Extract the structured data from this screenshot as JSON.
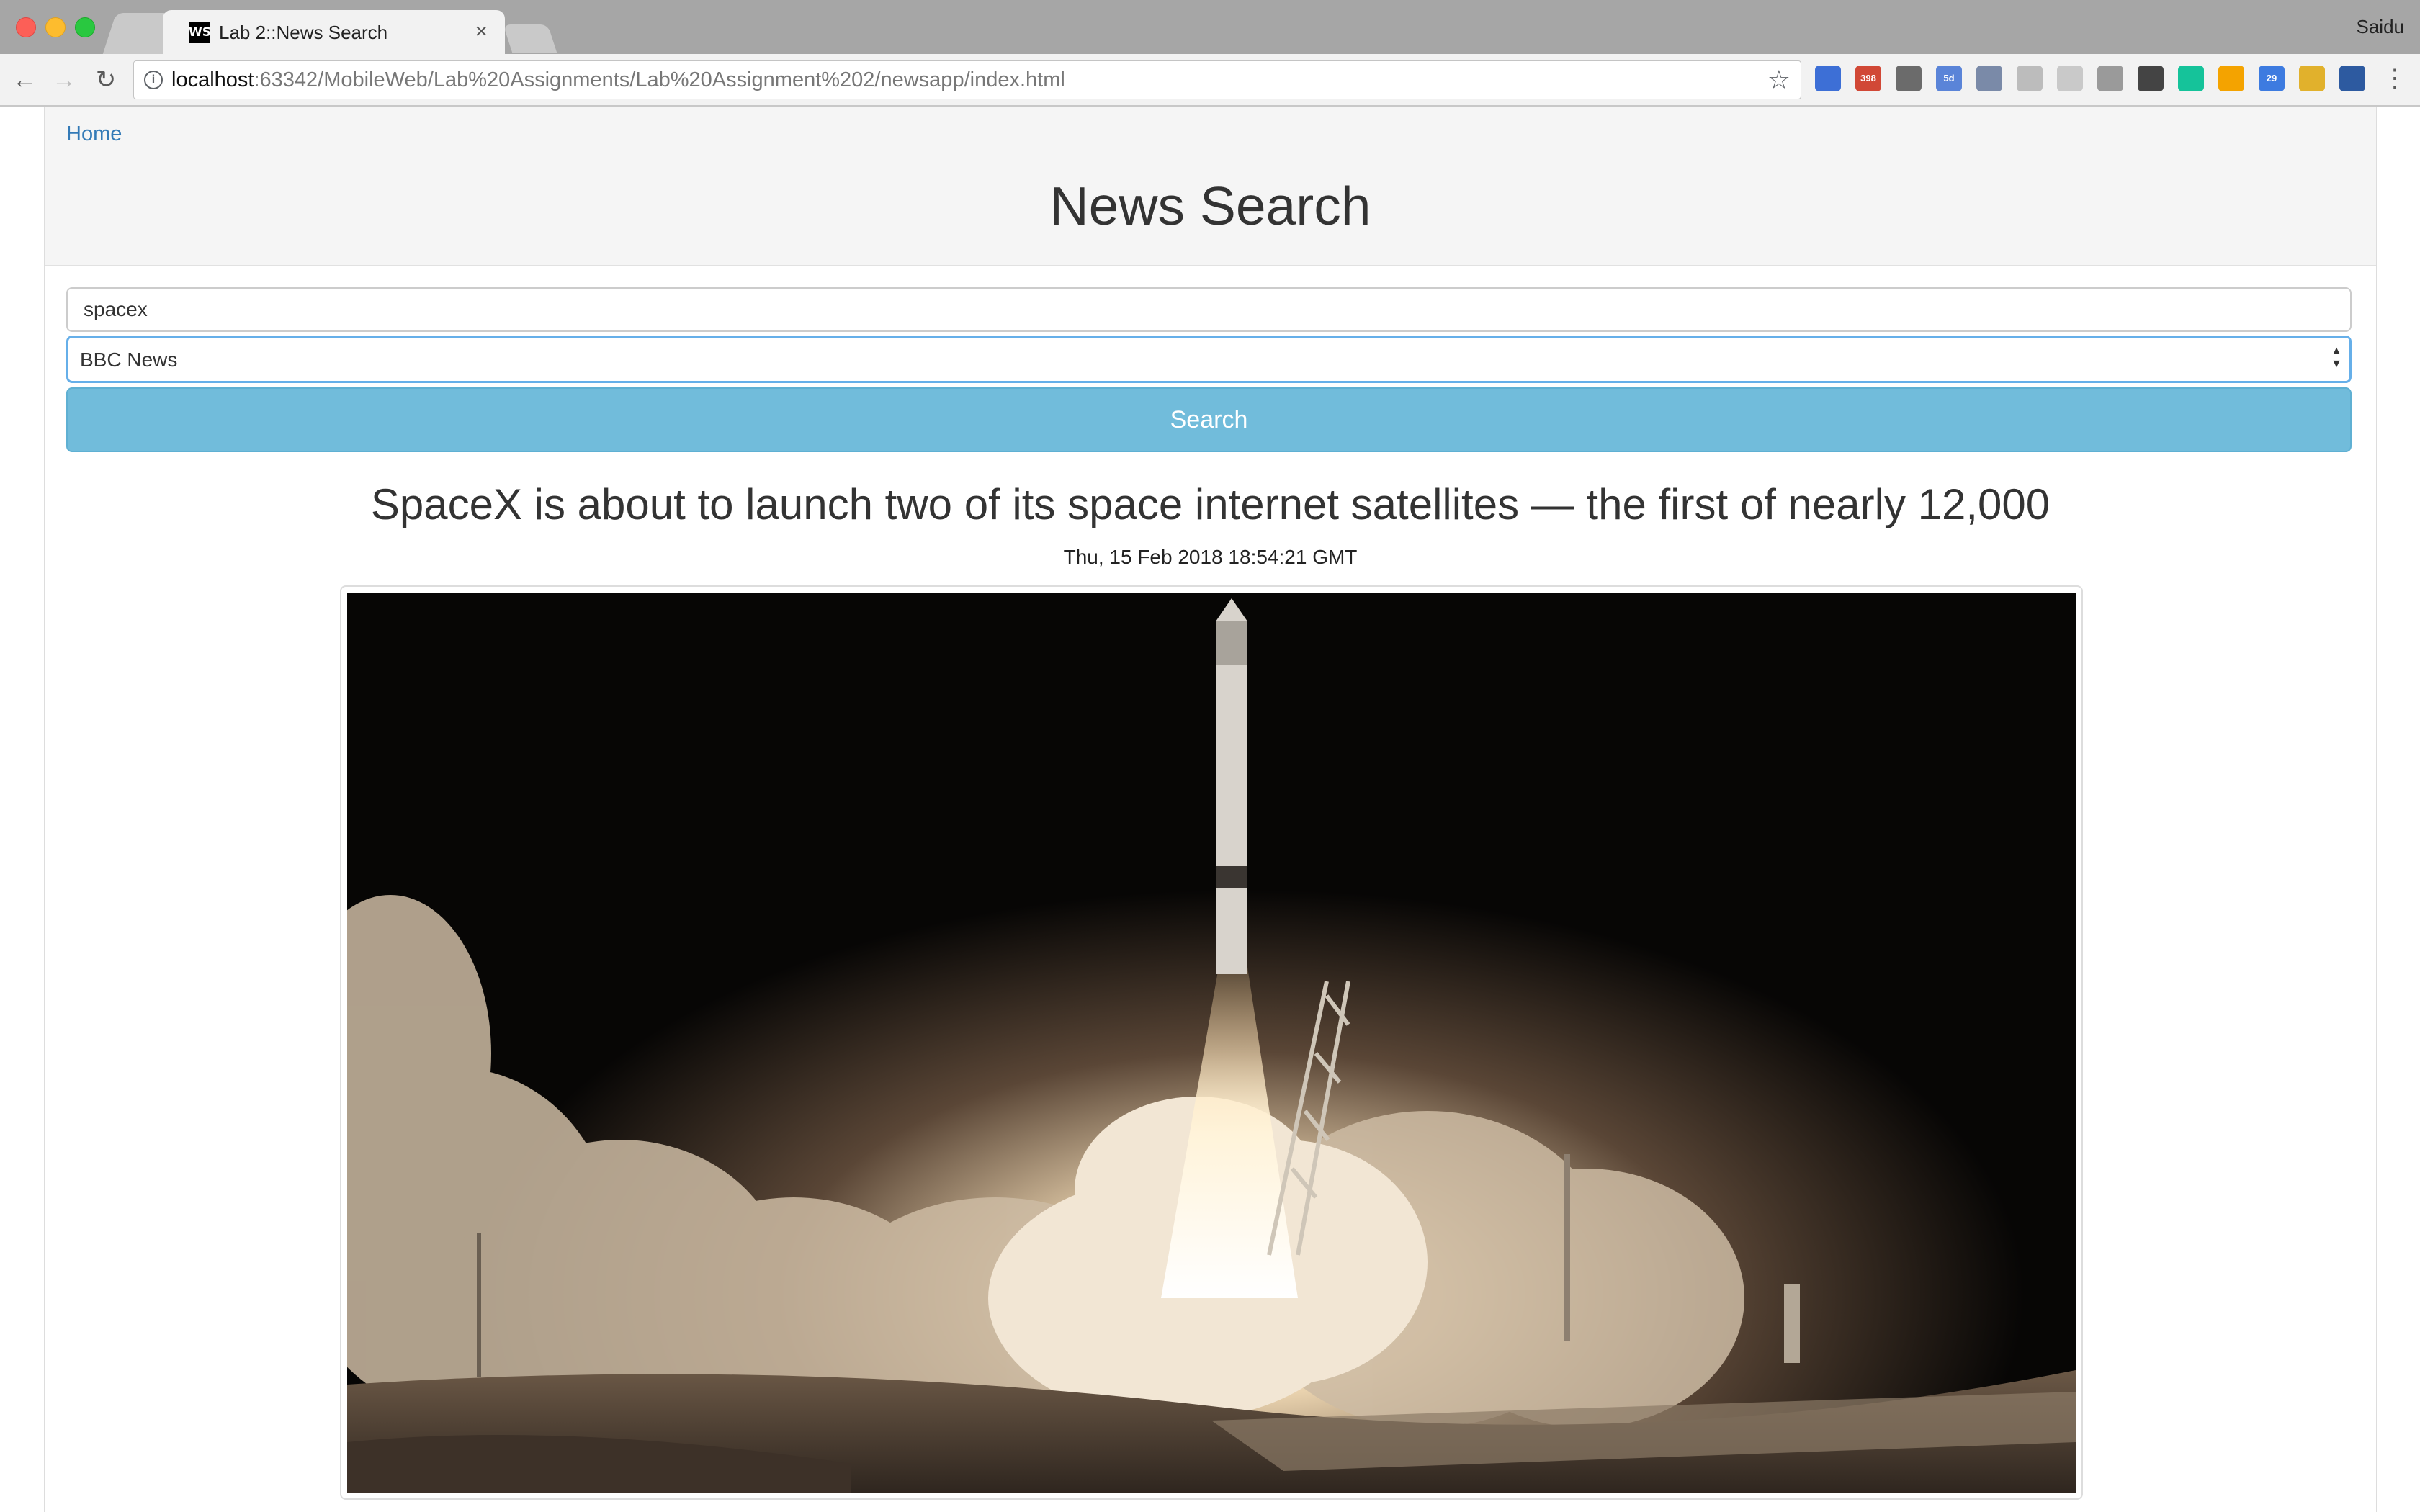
{
  "browser": {
    "tab_title": "Lab 2::News Search",
    "tab_favicon_text": "WS",
    "tab_close": "×",
    "profile_name": "Saidu",
    "url_host": "localhost",
    "url_rest": ":63342/MobileWeb/Lab%20Assignments/Lab%20Assignment%202/newsapp/index.html",
    "extensions": [
      {
        "name": "mic-extension-icon",
        "color": "#3d6fd6",
        "badge": ""
      },
      {
        "name": "gmail-extension-icon",
        "color": "#d14836",
        "badge": "398"
      },
      {
        "name": "mail-extension-icon",
        "color": "#6b6b6b",
        "badge": ""
      },
      {
        "name": "calendar-extension-icon",
        "color": "#5a84d8",
        "badge": "5d"
      },
      {
        "name": "equalizer-extension-icon",
        "color": "#7a8aa8",
        "badge": ""
      },
      {
        "name": "translate-extension-icon",
        "color": "#bcbcbc",
        "badge": ""
      },
      {
        "name": "screenshot-extension-icon",
        "color": "#c9c9c9",
        "badge": ""
      },
      {
        "name": "wordcount-extension-icon",
        "color": "#9a9a9a",
        "badge": ""
      },
      {
        "name": "download-extension-icon",
        "color": "#444444",
        "badge": ""
      },
      {
        "name": "grammarly-extension-icon",
        "color": "#15c39a",
        "badge": ""
      },
      {
        "name": "photos-extension-icon",
        "color": "#f4a300",
        "badge": ""
      },
      {
        "name": "calendar2-extension-icon",
        "color": "#3d7be0",
        "badge": "29"
      },
      {
        "name": "clock-extension-icon",
        "color": "#e1b12c",
        "badge": ""
      },
      {
        "name": "play-extension-icon",
        "color": "#2d5aa0",
        "badge": ""
      }
    ]
  },
  "nav": {
    "home_label": "Home"
  },
  "header": {
    "title": "News Search"
  },
  "search": {
    "query": "spacex",
    "source_selected": "BBC News",
    "button_label": "Search"
  },
  "article": {
    "title": "SpaceX is about to launch two of its space internet satellites — the first of nearly 12,000",
    "date": "Thu, 15 Feb 2018 18:54:21 GMT"
  },
  "colors": {
    "link": "#337ab7",
    "search_button": "#71bcdb",
    "select_focus": "#66afe9"
  }
}
